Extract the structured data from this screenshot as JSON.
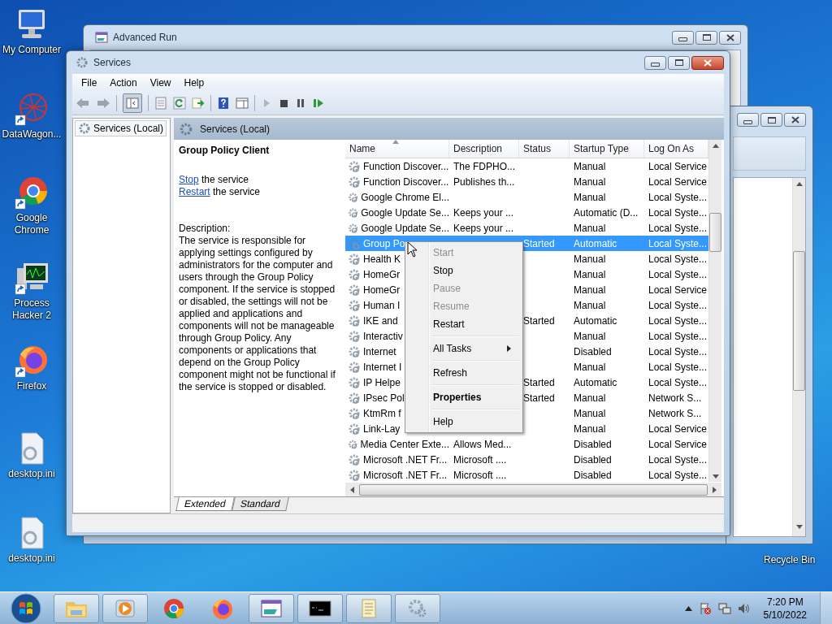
{
  "desktop_icons": [
    {
      "label": "My Computer",
      "kind": "computer",
      "shortcut": false
    },
    {
      "label": "DataWagon...",
      "kind": "web",
      "shortcut": true
    },
    {
      "label": "Google Chrome",
      "kind": "chrome",
      "shortcut": true
    },
    {
      "label": "Process Hacker 2",
      "kind": "monitor",
      "shortcut": true
    },
    {
      "label": "Firefox",
      "kind": "firefox",
      "shortcut": true
    },
    {
      "label": "desktop.ini",
      "kind": "file",
      "shortcut": false
    },
    {
      "label": "desktop.ini",
      "kind": "file",
      "shortcut": false
    }
  ],
  "recycle_bin": {
    "label": "Recycle Bin"
  },
  "advanced_run": {
    "title": "Advanced Run"
  },
  "services_window": {
    "title": "Services",
    "menu": [
      "File",
      "Action",
      "View",
      "Help"
    ],
    "tree": [
      {
        "label": "Services (Local)",
        "selected": true
      }
    ],
    "pane_title": "Services (Local)",
    "details": {
      "heading": "Group Policy Client",
      "actions": [
        {
          "link": "Stop",
          "text": "the service"
        },
        {
          "link": "Restart",
          "text": "the service"
        }
      ],
      "description_label": "Description:",
      "description": "The service is responsible for applying settings configured by administrators for the computer and users through the Group Policy component. If the service is stopped or disabled, the settings will not be applied and applications and components will not be manageable through Group Policy. Any components or applications that depend on the Group Policy component might not be functional if the service is stopped or disabled."
    },
    "table": {
      "columns": [
        {
          "label": "Name",
          "sorted": true
        },
        {
          "label": "Description",
          "sorted": false
        },
        {
          "label": "Status",
          "sorted": false
        },
        {
          "label": "Startup Type",
          "sorted": false
        },
        {
          "label": "Log On As",
          "sorted": false
        }
      ],
      "rows": [
        {
          "name": "Function Discover...",
          "description": "The FDPHO...",
          "startup": "Manual",
          "logon": "Local Service",
          "selected": false
        },
        {
          "name": "Function Discover...",
          "description": "Publishes th...",
          "startup": "Manual",
          "logon": "Local Service",
          "selected": false
        },
        {
          "name": "Google Chrome El...",
          "startup": "Manual",
          "logon": "Local Syste...",
          "selected": false
        },
        {
          "name": "Google Update Se...",
          "description": "Keeps your ...",
          "startup": "Automatic (D...",
          "logon": "Local Syste...",
          "selected": false
        },
        {
          "name": "Google Update Se...",
          "description": "Keeps your ...",
          "startup": "Manual",
          "logon": "Local Syste...",
          "selected": false
        },
        {
          "name": "Group Po",
          "status": "Started",
          "startup": "Automatic",
          "logon": "Local Syste...",
          "selected": true
        },
        {
          "name": "Health K",
          "startup": "Manual",
          "logon": "Local Syste...",
          "selected": false
        },
        {
          "name": "HomeGr",
          "startup": "Manual",
          "logon": "Local Syste...",
          "selected": false
        },
        {
          "name": "HomeGr",
          "startup": "Manual",
          "logon": "Local Service",
          "selected": false
        },
        {
          "name": "Human I",
          "startup": "Manual",
          "logon": "Local Syste...",
          "selected": false
        },
        {
          "name": "IKE and",
          "status": "Started",
          "startup": "Automatic",
          "logon": "Local Syste...",
          "selected": false
        },
        {
          "name": "Interactiv",
          "startup": "Manual",
          "logon": "Local Syste...",
          "selected": false
        },
        {
          "name": "Internet",
          "startup": "Disabled",
          "logon": "Local Syste...",
          "selected": false
        },
        {
          "name": "Internet I",
          "startup": "Manual",
          "logon": "Local Syste...",
          "selected": false
        },
        {
          "name": "IP Helpe",
          "status": "Started",
          "startup": "Automatic",
          "logon": "Local Syste...",
          "selected": false
        },
        {
          "name": "IPsec Pol",
          "status": "Started",
          "startup": "Manual",
          "logon": "Network S...",
          "selected": false
        },
        {
          "name": "KtmRm f",
          "startup": "Manual",
          "logon": "Network S...",
          "selected": false
        },
        {
          "name": "Link-Lay",
          "startup": "Manual",
          "logon": "Local Service",
          "selected": false
        },
        {
          "name": "Media Center Exte...",
          "description": "Allows Med...",
          "startup": "Disabled",
          "logon": "Local Service",
          "selected": false
        },
        {
          "name": "Microsoft .NET Fr...",
          "description": "Microsoft ....",
          "startup": "Disabled",
          "logon": "Local Syste...",
          "selected": false
        },
        {
          "name": "Microsoft .NET Fr...",
          "description": "Microsoft ....",
          "startup": "Disabled",
          "logon": "Local Syste...",
          "selected": false
        }
      ]
    },
    "view_tabs": [
      {
        "label": "Extended",
        "selected": true
      },
      {
        "label": "Standard",
        "selected": false
      }
    ]
  },
  "context_menu": [
    {
      "kind": "item",
      "label": "Start",
      "disabled": true,
      "bold": false,
      "submenu": false
    },
    {
      "kind": "item",
      "label": "Stop",
      "disabled": false,
      "bold": false,
      "submenu": false
    },
    {
      "kind": "item",
      "label": "Pause",
      "disabled": true,
      "bold": false,
      "submenu": false
    },
    {
      "kind": "item",
      "label": "Resume",
      "disabled": true,
      "bold": false,
      "submenu": false
    },
    {
      "kind": "item",
      "label": "Restart",
      "disabled": false,
      "bold": false,
      "submenu": false
    },
    {
      "kind": "separator"
    },
    {
      "kind": "item",
      "label": "All Tasks",
      "disabled": false,
      "bold": false,
      "submenu": true
    },
    {
      "kind": "separator"
    },
    {
      "kind": "item",
      "label": "Refresh",
      "disabled": false,
      "bold": false,
      "submenu": false
    },
    {
      "kind": "separator"
    },
    {
      "kind": "item",
      "label": "Properties",
      "disabled": false,
      "bold": true,
      "submenu": false
    },
    {
      "kind": "separator"
    },
    {
      "kind": "item",
      "label": "Help",
      "disabled": false,
      "bold": false,
      "submenu": false
    }
  ],
  "taskbar": {
    "apps": [
      {
        "kind": "explorer",
        "running": true
      },
      {
        "kind": "media",
        "running": true
      },
      {
        "kind": "chrome",
        "running": false
      },
      {
        "kind": "firefox",
        "running": false
      },
      {
        "kind": "advancedrun",
        "running": true
      },
      {
        "kind": "cmd",
        "running": true
      },
      {
        "kind": "notepad",
        "running": true
      },
      {
        "kind": "services",
        "running": true
      }
    ],
    "time": "7:20 PM",
    "date": "5/10/2022"
  }
}
